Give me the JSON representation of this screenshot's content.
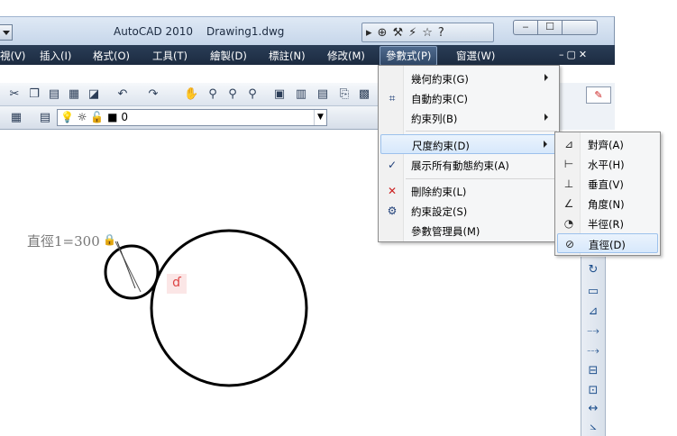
{
  "title": {
    "app_name": "AutoCAD 2010",
    "document_name": "Drawing1.dwg"
  },
  "infocenter": {
    "icons": [
      "binoculars-icon",
      "wrench-icon",
      "satellite-icon",
      "star-icon",
      "help-icon"
    ],
    "help_glyph": "?"
  },
  "menubar": {
    "items": [
      {
        "label": "視(V)"
      },
      {
        "label": "插入(I)"
      },
      {
        "label": "格式(O)"
      },
      {
        "label": "工具(T)"
      },
      {
        "label": "繪製(D)"
      },
      {
        "label": "標註(N)"
      },
      {
        "label": "修改(M)"
      },
      {
        "label": "參數式(P)"
      },
      {
        "label": "窗選(W)"
      }
    ],
    "active_index": 7
  },
  "layer_toolbar": {
    "current_layer": "0"
  },
  "drawing": {
    "dimension_label": "直徑1=300"
  },
  "parametric_menu": {
    "items": [
      {
        "label": "幾何約束(G)",
        "submenu": true
      },
      {
        "label": "自動約束(C)",
        "submenu": false
      },
      {
        "label": "約束列(B)",
        "submenu": true
      },
      {
        "label": "尺度約束(D)",
        "submenu": true,
        "selected": true
      },
      {
        "label": "展示所有動態約束(A)",
        "checked": true
      },
      {
        "label": "刪除約束(L)"
      },
      {
        "label": "約束設定(S)"
      },
      {
        "label": "參數管理員(M)"
      }
    ]
  },
  "dimensional_submenu": {
    "items": [
      {
        "label": "對齊(A)"
      },
      {
        "label": "水平(H)"
      },
      {
        "label": "垂直(V)"
      },
      {
        "label": "角度(N)"
      },
      {
        "label": "半徑(R)"
      },
      {
        "label": "直徑(D)",
        "selected": true
      }
    ]
  },
  "colors": {
    "menubar_bg": "#1c2b40",
    "selection_bg": "#d7e8fb",
    "selection_border": "#9cc1ec"
  }
}
